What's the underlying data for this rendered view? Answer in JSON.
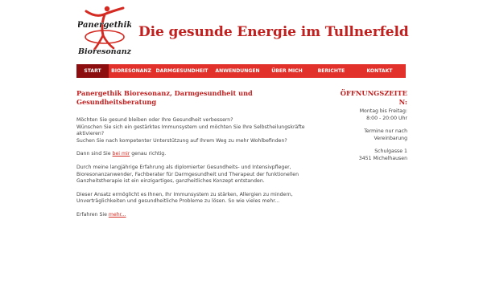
{
  "header": {
    "logo_text_top": "Panergethik",
    "logo_text_bottom": "Bioresonanz",
    "title": "Die gesunde Energie im Tullnerfeld"
  },
  "nav": {
    "items": [
      {
        "label": "Start",
        "active": true
      },
      {
        "label": "Bioresonanz"
      },
      {
        "label": "Darmgesundheit"
      },
      {
        "label": "Anwendungen"
      },
      {
        "label": "Über mich"
      },
      {
        "label": "Berichte"
      },
      {
        "label": "Kontakt"
      }
    ]
  },
  "main": {
    "heading": "Panergethik Bioresonanz, Darmgesundheit und Gesundheitsberatung",
    "p1_l1": "Möchten Sie gesund bleiben oder Ihre Gesundheit verbessern?",
    "p1_l2": "Wünschen Sie sich ein gestärktes Immunsystem und möchten Sie Ihre Selbstheilungskräfte aktivieren?",
    "p1_l3": "Suchen Sie nach kompetenter Unterstützung auf Ihrem Weg zu mehr Wohlbefinden?",
    "p2_before": "Dann sind Sie ",
    "p2_link": "bei mir",
    "p2_after": " genau richtig.",
    "p3": "Durch meine langjährige Erfahrung als diplomierter Gesundheits- und Intensivpfleger, Bioresonanzanwender, Fachberater für Darmgesundheit und Therapeut der funktionellen Ganzheitstherapie ist ein einzigartiges, ganzheitliches Konzept entstanden.",
    "p4": "Dieser Ansatz ermöglicht es Ihnen, Ihr Immunsystem zu stärken, Allergien zu mindern, Unverträglichkeiten und gesundheitliche Probleme zu lösen. So wie vieles mehr...",
    "p5_before": "Erfahren Sie ",
    "p5_link": "mehr..."
  },
  "sidebar": {
    "heading": "ÖFFNUNGSZEITEN:",
    "hours_l1": "Montag bis Freitag:",
    "hours_l2": "8:00 - 20:00 Uhr",
    "appt_l1": "Termine nur nach",
    "appt_l2": "Vereinbarung",
    "addr_l1": "Schulgasse 1",
    "addr_l2": "3451 Michelhausen"
  },
  "colors": {
    "brand_red": "#c21f1f",
    "nav_red": "#e2312a",
    "nav_active": "#8c0e0e"
  }
}
